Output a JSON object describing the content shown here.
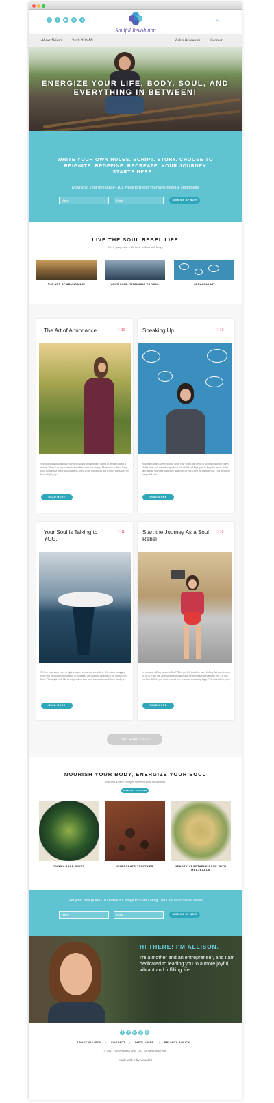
{
  "header": {
    "logo_text": "Soulful Revolution",
    "social_icons": [
      "facebook-icon",
      "twitter-icon",
      "youtube-icon",
      "instagram-icon",
      "pinterest-icon"
    ],
    "nav": [
      "About Allison",
      "Work With Me",
      "Rebel Resources",
      "Contact"
    ]
  },
  "hero": {
    "headline": "ENERGIZE YOUR LIFE, BODY, SOUL, AND EVERYTHING IN BETWEEN!"
  },
  "signup": {
    "tagline": "WRITE YOUR OWN RULES. SCRIPT. STORY. CHOOSE TO REIGNITE. REDEFINE. RECREATE. YOUR JOURNEY STARTS HERE...",
    "guide_text": "Download your free guide- 101 Ways to Boost Your Well-Being & Happiness",
    "name_placeholder": "Name",
    "email_placeholder": "Email",
    "button": "SIGN ME UP NOW"
  },
  "soul_rebel": {
    "heading": "LIVE THE SOUL REBEL LIFE",
    "subheading": "Get a jump start with these videos and blogs",
    "items": [
      "THE ART OF ABUNDANCE",
      "YOUR SOUL IS TALKING TO YOU..",
      "SPEAKING UP"
    ]
  },
  "posts": [
    {
      "title": "The Art of Abundance",
      "likes": "10",
      "excerpt": "When thinking of abundance the first thought that generally comes to people's minds is money. There is so much more to abundance than just money. Abundance is about living fully, no purpose in joy and happiness. Most of the world lives in a scarcity mentality. We have a tight grip...",
      "button": "READ MORE"
    },
    {
      "title": "Speaking Up",
      "likes": "10",
      "excerpt": "How many times have you push down your words and needs to accommodate for others. Or the times you wanted to speak up, but stifled and kept quiet to keep the peace. In the past, maybe you were dismissed, dismissed or ostracized for speaking out. This may have compelled you...",
      "button": "READ MORE"
    },
    {
      "title": "Your Soul is Talking to YOU..",
      "likes": "11",
      "excerpt": "At first, your inner voice is light whisper in your ear, silent there it becomes a nagging voice that gets louder to the point of shouting. The shouting turns into a big thump over head. That might look like first a problem, then turns into a crisis and then... finally a...",
      "button": "READ MORE"
    },
    {
      "title": "Start the Journey As a Soul Rebel",
      "likes": "10",
      "excerpt": "Is your soul calling for a rebellion? Have you felt this deep inner feeling that there is more to life? Or that you have different thoughts and feelings that others around you? Or that you have beliefs you want to break free to pursue something bigger? Get started on your...",
      "button": "READ MORE"
    }
  ],
  "load_more": "LOAD MORE POSTS",
  "recipes": {
    "heading": "NOURISH YOUR BODY, ENERGIZE YOUR SOUL",
    "subheading": "Nutrient Dense Recipes to Feed Your Soul Rebel",
    "button": "VIEW ALL RECIPES",
    "items": [
      "FUNNY KALE CHIPS",
      "CHOCOLATE TRUFFLES",
      "HEARTY VEGETABLE SOUP WITH MEATBALLS"
    ]
  },
  "signup2": {
    "guide_text": "Get your free guide - 10 Powerful Ways to Start Living The Life Your Soul Craves",
    "name_placeholder": "Name",
    "email_placeholder": "Email",
    "button": "SIGN ME UP NOW"
  },
  "about": {
    "heading": "HI THERE! I'M ALLISON.",
    "text": "I'm a mother and an entrepreneur, and I am dedicated to leading you to a more joyful, vibrant and fulfilling life."
  },
  "footer": {
    "links": [
      "ABOUT ALLISON",
      "CONTACT",
      "DISCLAIMER",
      "PRIVACY POLICY"
    ],
    "copyright": "© 2017 The Wellness Way, LLC. All rights reserved.",
    "credit": "Made with ♥ by Visual23"
  },
  "colors": {
    "accent": "#5fc3d2",
    "button": "#2fa7ba",
    "heart": "#e0506a"
  }
}
